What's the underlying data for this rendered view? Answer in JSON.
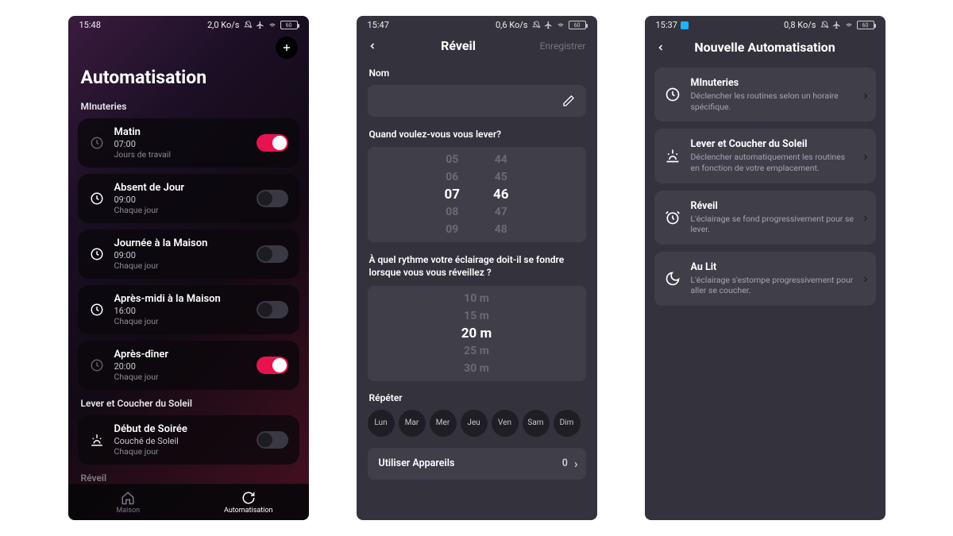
{
  "statusbar": {
    "s1": {
      "time": "15:48",
      "rate": "2,0 Ko/s",
      "battery": "60"
    },
    "s2": {
      "time": "15:47",
      "rate": "0,6 Ko/s",
      "battery": "60"
    },
    "s3": {
      "time": "15:37",
      "rate": "0,8 Ko/s",
      "battery": "60"
    }
  },
  "screen1": {
    "title": "Automatisation",
    "section_timers": "MInuteries",
    "section_sun": "Lever et Coucher du Soleil",
    "section_wake_cut": "Réveil",
    "items": [
      {
        "name": "Matin",
        "time": "07:00",
        "sub": "Jours de travail",
        "on": true,
        "icon": "clock"
      },
      {
        "name": "Absent de Jour",
        "time": "09:00",
        "sub": "Chaque jour",
        "on": false,
        "icon": "clock"
      },
      {
        "name": "Journée à la Maison",
        "time": "09:00",
        "sub": "Chaque jour",
        "on": false,
        "icon": "clock"
      },
      {
        "name": "Après-midi à la Maison",
        "time": "16:00",
        "sub": "Chaque jour",
        "on": false,
        "icon": "clock"
      },
      {
        "name": "Après-dîner",
        "time": "20:00",
        "sub": "Chaque jour",
        "on": true,
        "icon": "clock"
      }
    ],
    "sun_item": {
      "name": "Début de Soirée",
      "time": "Couché de Soleil",
      "sub": "Chaque jour",
      "on": false
    },
    "tabs": {
      "home": "Maison",
      "auto": "Automatisation"
    }
  },
  "screen2": {
    "title": "Réveil",
    "save": "Enregistrer",
    "label_name": "Nom",
    "q_time": "Quand voulez-vous vous lever?",
    "hours": [
      "05",
      "06",
      "07",
      "08",
      "09"
    ],
    "minutes": [
      "44",
      "45",
      "46",
      "47",
      "48"
    ],
    "selected_hour": "07",
    "selected_minute": "46",
    "q_fade": "À quel rythme votre éclairage doit-il se fondre lorsque vous vous réveillez ?",
    "fade_options": [
      "10 m",
      "15 m",
      "20 m",
      "25 m",
      "30 m"
    ],
    "selected_fade": "20 m",
    "label_repeat": "Répéter",
    "days": [
      "Lun",
      "Mar",
      "Mer",
      "Jeu",
      "Ven",
      "Sam",
      "Dim"
    ],
    "use_devices_label": "Utiliser Appareils",
    "use_devices_count": "0"
  },
  "screen3": {
    "title": "Nouvelle Automatisation",
    "options": [
      {
        "name": "MInuteries",
        "desc": "Déclencher les routines selon un horaire spécifique.",
        "icon": "clock"
      },
      {
        "name": "Lever et Coucher du Soleil",
        "desc": "Déclencher automatiquement les routines en fonction de votre emplacement.",
        "icon": "sunset"
      },
      {
        "name": "Réveil",
        "desc": "L'éclairage se fond progressivement pour se lever.",
        "icon": "alarm"
      },
      {
        "name": "Au Lit",
        "desc": "L'éclairage s'estompe progressivement pour aller se coucher.",
        "icon": "moon"
      }
    ]
  }
}
